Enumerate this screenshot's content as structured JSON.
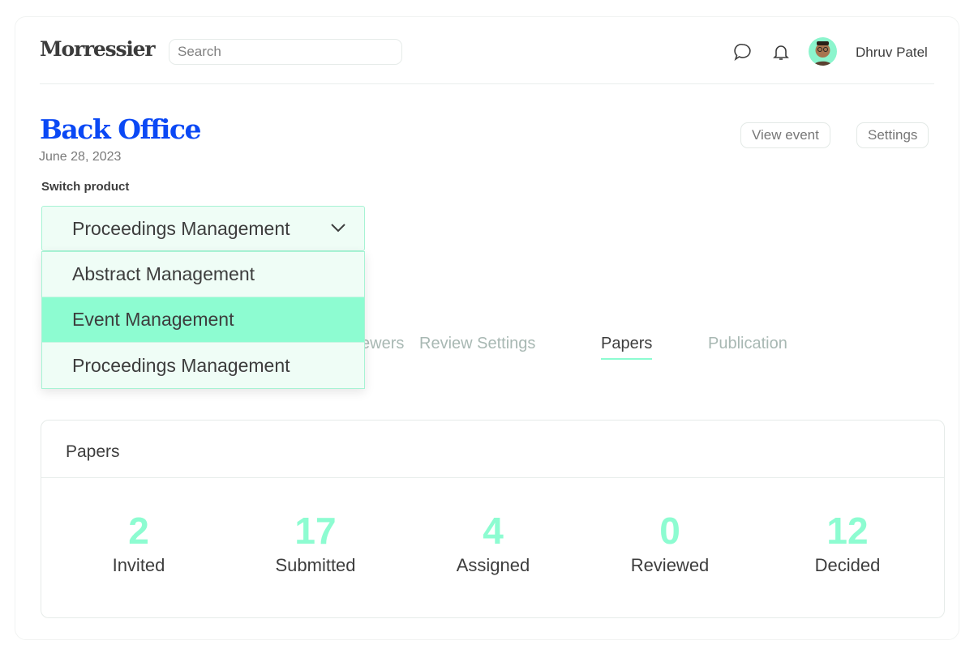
{
  "header": {
    "logo": "Morressier",
    "search_placeholder": "Search",
    "user_name": "Dhruv Patel",
    "icons": [
      "chat-bubble-icon",
      "bell-icon"
    ]
  },
  "page": {
    "title": "Back Office",
    "date": "June 28, 2023",
    "view_event": "View event",
    "settings": "Settings"
  },
  "switcher": {
    "label": "Switch product",
    "selected": "Proceedings Management",
    "options": [
      {
        "label": "Abstract Management"
      },
      {
        "label": "Event Management",
        "highlighted": true
      },
      {
        "label": "Proceedings Management"
      }
    ]
  },
  "tabs": [
    {
      "label": "Reviewers"
    },
    {
      "label": "Review Settings"
    },
    {
      "label": "Papers",
      "active": true
    },
    {
      "label": "Publication"
    }
  ],
  "papers": {
    "title": "Papers",
    "stats": [
      {
        "value": "2",
        "label": "Invited"
      },
      {
        "value": "17",
        "label": "Submitted"
      },
      {
        "value": "4",
        "label": "Assigned"
      },
      {
        "value": "0",
        "label": "Reviewed"
      },
      {
        "value": "12",
        "label": "Decided"
      }
    ]
  },
  "colors": {
    "accent": "#8dfcd1",
    "brand": "#0a48f5"
  }
}
